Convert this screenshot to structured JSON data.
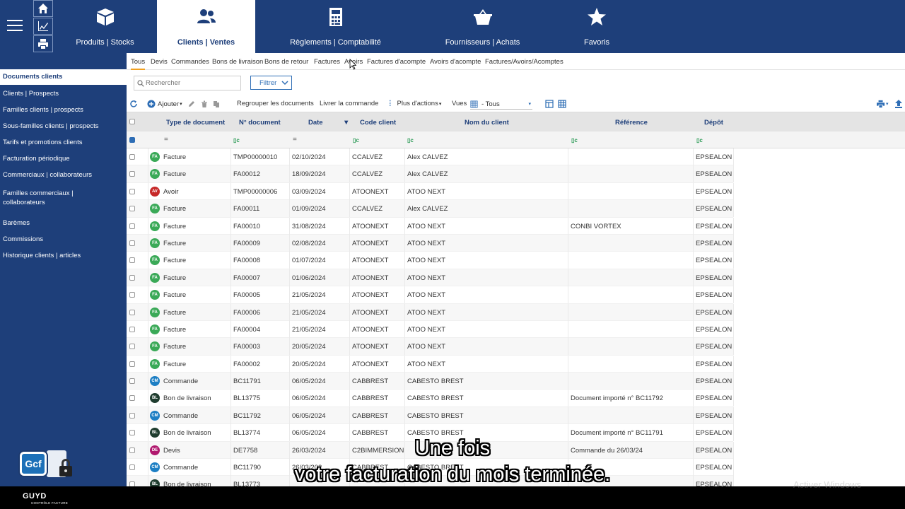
{
  "nav": {
    "modules": [
      {
        "label": "Produits | Stocks",
        "icon": "box-icon"
      },
      {
        "label": "Clients | Ventes",
        "icon": "users-icon",
        "active": true
      },
      {
        "label": "Règlements | Comptabilité",
        "icon": "calculator-icon"
      },
      {
        "label": "Fournisseurs | Achats",
        "icon": "basket-icon"
      },
      {
        "label": "Favoris",
        "icon": "star-icon"
      }
    ],
    "quick_actions": [
      "home-icon",
      "chart-icon",
      "print-icon"
    ]
  },
  "sidebar": {
    "items": [
      "Documents clients",
      "Clients | Prospects",
      "Familles clients | prospects",
      "Sous-familles clients | prospects",
      "Tarifs et promotions clients",
      "Facturation périodique",
      "Commerciaux | collaborateurs",
      "Familles commerciaux |",
      "collaborateurs",
      "Barèmes",
      "Commissions",
      "Historique clients | articles"
    ],
    "logo_text": "Gcf"
  },
  "tabs": [
    "Tous",
    "Devis",
    "Commandes",
    "Bons de livraison",
    "Bons de retour",
    "Factures",
    "Avoirs",
    "Factures d'acompte",
    "Avoirs d'acompte",
    "Factures/Avoirs/Acomptes"
  ],
  "search": {
    "placeholder": "Rechercher",
    "filter_label": "Filtrer"
  },
  "toolbar": {
    "add_label": "Ajouter",
    "group_label": "Regrouper les documents",
    "deliver_label": "Livrer la commande",
    "more_label": "Plus d'actions",
    "views_label": "Vues",
    "views_value": "- Tous"
  },
  "table": {
    "headers": [
      "Type de document",
      "N° document",
      "Date",
      "Code client",
      "Nom du client",
      "Référence",
      "Dépôt"
    ],
    "rows": [
      {
        "badge": "FA",
        "color": "#3aa957",
        "type": "Facture",
        "num": "TMP00000010",
        "date": "02/10/2024",
        "code": "CCALVEZ",
        "name": "Alex CALVEZ",
        "ref": "",
        "depot": "EPSEALON"
      },
      {
        "badge": "FA",
        "color": "#3aa957",
        "type": "Facture",
        "num": "FA00012",
        "date": "18/09/2024",
        "code": "CCALVEZ",
        "name": "Alex CALVEZ",
        "ref": "",
        "depot": "EPSEALON"
      },
      {
        "badge": "AV",
        "color": "#c62828",
        "type": "Avoir",
        "num": "TMP00000006",
        "date": "03/09/2024",
        "code": "ATOONEXT",
        "name": "ATOO NEXT",
        "ref": "",
        "depot": "EPSEALON"
      },
      {
        "badge": "FA",
        "color": "#3aa957",
        "type": "Facture",
        "num": "FA00011",
        "date": "01/09/2024",
        "code": "CCALVEZ",
        "name": "Alex CALVEZ",
        "ref": "",
        "depot": "EPSEALON"
      },
      {
        "badge": "FA",
        "color": "#3aa957",
        "type": "Facture",
        "num": "FA00010",
        "date": "31/08/2024",
        "code": "ATOONEXT",
        "name": "ATOO NEXT",
        "ref": "CONBI VORTEX",
        "depot": "EPSEALON"
      },
      {
        "badge": "FA",
        "color": "#3aa957",
        "type": "Facture",
        "num": "FA00009",
        "date": "02/08/2024",
        "code": "ATOONEXT",
        "name": "ATOO NEXT",
        "ref": "",
        "depot": "EPSEALON"
      },
      {
        "badge": "FA",
        "color": "#3aa957",
        "type": "Facture",
        "num": "FA00008",
        "date": "01/07/2024",
        "code": "ATOONEXT",
        "name": "ATOO NEXT",
        "ref": "",
        "depot": "EPSEALON"
      },
      {
        "badge": "FA",
        "color": "#3aa957",
        "type": "Facture",
        "num": "FA00007",
        "date": "01/06/2024",
        "code": "ATOONEXT",
        "name": "ATOO NEXT",
        "ref": "",
        "depot": "EPSEALON"
      },
      {
        "badge": "FA",
        "color": "#3aa957",
        "type": "Facture",
        "num": "FA00005",
        "date": "21/05/2024",
        "code": "ATOONEXT",
        "name": "ATOO NEXT",
        "ref": "",
        "depot": "EPSEALON"
      },
      {
        "badge": "FA",
        "color": "#3aa957",
        "type": "Facture",
        "num": "FA00006",
        "date": "21/05/2024",
        "code": "ATOONEXT",
        "name": "ATOO NEXT",
        "ref": "",
        "depot": "EPSEALON"
      },
      {
        "badge": "FA",
        "color": "#3aa957",
        "type": "Facture",
        "num": "FA00004",
        "date": "21/05/2024",
        "code": "ATOONEXT",
        "name": "ATOO NEXT",
        "ref": "",
        "depot": "EPSEALON"
      },
      {
        "badge": "FA",
        "color": "#3aa957",
        "type": "Facture",
        "num": "FA00003",
        "date": "20/05/2024",
        "code": "ATOONEXT",
        "name": "ATOO NEXT",
        "ref": "",
        "depot": "EPSEALON"
      },
      {
        "badge": "FA",
        "color": "#3aa957",
        "type": "Facture",
        "num": "FA00002",
        "date": "20/05/2024",
        "code": "ATOONEXT",
        "name": "ATOO NEXT",
        "ref": "",
        "depot": "EPSEALON"
      },
      {
        "badge": "CM",
        "color": "#1d7fc4",
        "type": "Commande",
        "num": "BC11791",
        "date": "06/05/2024",
        "code": "CABBREST",
        "name": "CABESTO BREST",
        "ref": "",
        "depot": "EPSEALON"
      },
      {
        "badge": "BL",
        "color": "#1f3d2f",
        "type": "Bon de livraison",
        "num": "BL13775",
        "date": "06/05/2024",
        "code": "CABBREST",
        "name": "CABESTO BREST",
        "ref": "Document importé n° BC11792",
        "depot": "EPSEALON"
      },
      {
        "badge": "CM",
        "color": "#1d7fc4",
        "type": "Commande",
        "num": "BC11792",
        "date": "06/05/2024",
        "code": "CABBREST",
        "name": "CABESTO BREST",
        "ref": "",
        "depot": "EPSEALON"
      },
      {
        "badge": "BL",
        "color": "#1f3d2f",
        "type": "Bon de livraison",
        "num": "BL13774",
        "date": "06/05/2024",
        "code": "CABBREST",
        "name": "CABESTO BREST",
        "ref": "Document importé n° BC11791",
        "depot": "EPSEALON"
      },
      {
        "badge": "DE",
        "color": "#b0186e",
        "type": "Devis",
        "num": "DE7758",
        "date": "26/03/2024",
        "code": "C2BIMMERSION",
        "name": "",
        "ref": "Commande du 26/03/24",
        "depot": "EPSEALON"
      },
      {
        "badge": "CM",
        "color": "#1d7fc4",
        "type": "Commande",
        "num": "BC11790",
        "date": "26/03/202",
        "code": "CABBREST",
        "name": "CABESTO BREST",
        "ref": "",
        "depot": "EPSEALON"
      },
      {
        "badge": "BL",
        "color": "#1f3d2f",
        "type": "Bon de livraison",
        "num": "BL13773",
        "date": "",
        "code": "",
        "name": "",
        "ref": "",
        "depot": "EPSEALON"
      }
    ]
  },
  "subtitle": {
    "line1": "Une fois",
    "line2": "votre facturation du mois terminée."
  },
  "watermark": "Activer Windows",
  "brand": {
    "name": "GUYD",
    "tagline": "CONTRÔLE FACTURE"
  }
}
